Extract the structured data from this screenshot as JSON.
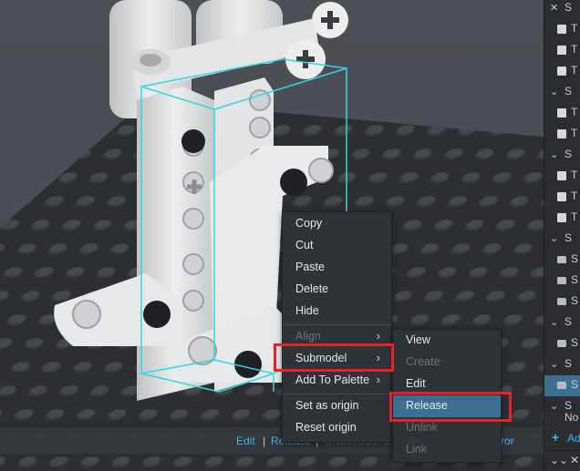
{
  "tree": {
    "rows": [
      {
        "chevron": "✕",
        "icon": "none",
        "label": "S"
      },
      {
        "chevron": "",
        "icon": "brick",
        "label": "T"
      },
      {
        "chevron": "",
        "icon": "brick",
        "label": "T"
      },
      {
        "chevron": "",
        "icon": "brick",
        "label": "T"
      },
      {
        "chevron": "⌄",
        "icon": "none",
        "label": "S"
      },
      {
        "chevron": "",
        "icon": "brick",
        "label": "T"
      },
      {
        "chevron": "",
        "icon": "brick",
        "label": "T"
      },
      {
        "chevron": "⌄",
        "icon": "none",
        "label": "S"
      },
      {
        "chevron": "",
        "icon": "brick",
        "label": "T"
      },
      {
        "chevron": "",
        "icon": "brick",
        "label": "T"
      },
      {
        "chevron": "",
        "icon": "brick",
        "label": "T"
      },
      {
        "chevron": "⌄",
        "icon": "none",
        "label": "S"
      },
      {
        "chevron": "",
        "icon": "folder",
        "label": "S"
      },
      {
        "chevron": "",
        "icon": "folder",
        "label": "S"
      },
      {
        "chevron": "",
        "icon": "folder",
        "label": "S"
      },
      {
        "chevron": "⌄",
        "icon": "none",
        "label": "S"
      },
      {
        "chevron": "",
        "icon": "folder",
        "label": "S"
      },
      {
        "chevron": "⌄",
        "icon": "none",
        "label": "S"
      },
      {
        "chevron": "",
        "icon": "folder",
        "label": "S",
        "selected": true
      },
      {
        "chevron": "⌄",
        "icon": "none",
        "label": "S"
      }
    ],
    "no_label": "No",
    "add_label": "Ad",
    "collapse_all": "⌄⌄",
    "close_all": "✕"
  },
  "statusbar": {
    "edit": "Edit",
    "sep1": "|",
    "release": "Release",
    "sep2": "|",
    "unlink": "Unlink from S",
    "error": "rror"
  },
  "context_menu": {
    "items": [
      {
        "label": "Copy",
        "enabled": true
      },
      {
        "label": "Cut",
        "enabled": true
      },
      {
        "label": "Paste",
        "enabled": true
      },
      {
        "label": "Delete",
        "enabled": true
      },
      {
        "label": "Hide",
        "enabled": true
      },
      {
        "label": "Align",
        "enabled": false,
        "submenu": true
      },
      {
        "label": "Submodel",
        "enabled": true,
        "submenu": true
      },
      {
        "label": "Add To Palette",
        "enabled": true,
        "submenu": true
      },
      {
        "label": "Set as origin",
        "enabled": true
      },
      {
        "label": "Reset origin",
        "enabled": true
      }
    ],
    "arrow": "›"
  },
  "submodel_menu": {
    "items": [
      {
        "label": "View",
        "enabled": true
      },
      {
        "label": "Create",
        "enabled": false
      },
      {
        "label": "Edit",
        "enabled": true
      },
      {
        "label": "Release",
        "enabled": true,
        "highlighted": true
      },
      {
        "label": "Unlink",
        "enabled": false
      },
      {
        "label": "Link",
        "enabled": false
      }
    ]
  },
  "colors": {
    "accent": "#3fb6e9",
    "highlight": "#3d6f93",
    "annotation": "#e0242a",
    "selection_outline": "#35d6e0"
  }
}
